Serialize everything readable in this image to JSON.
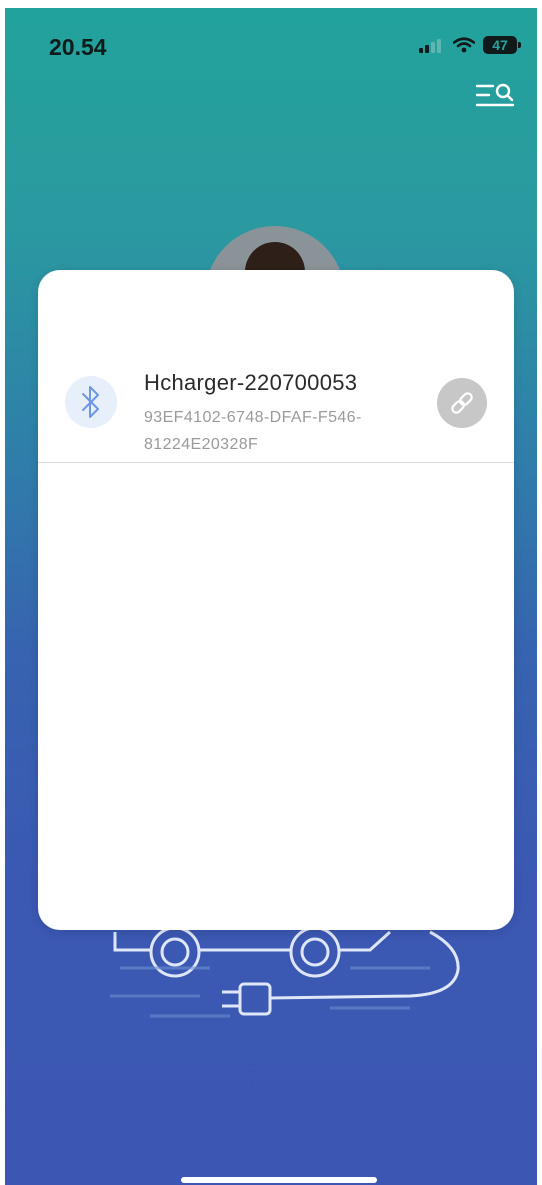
{
  "status_bar": {
    "time": "20.54",
    "battery": "47",
    "icons": [
      "signal-icon",
      "wifi-icon",
      "battery-icon"
    ]
  },
  "header": {
    "menu_icon": "menu-search-icon"
  },
  "modal": {
    "devices": [
      {
        "name": "Hcharger-220700053",
        "id": "93EF4102-6748-DFAF-F546-81224E20328F",
        "icon": "bluetooth-icon",
        "action_icon": "link-icon"
      }
    ]
  },
  "colors": {
    "gradient_top": "#22a29c",
    "gradient_bottom": "#3b57b3",
    "bluetooth_blue": "#6f96e6",
    "bluetooth_bg": "#e7effb",
    "connect_button_bg": "#c7c7c7"
  }
}
